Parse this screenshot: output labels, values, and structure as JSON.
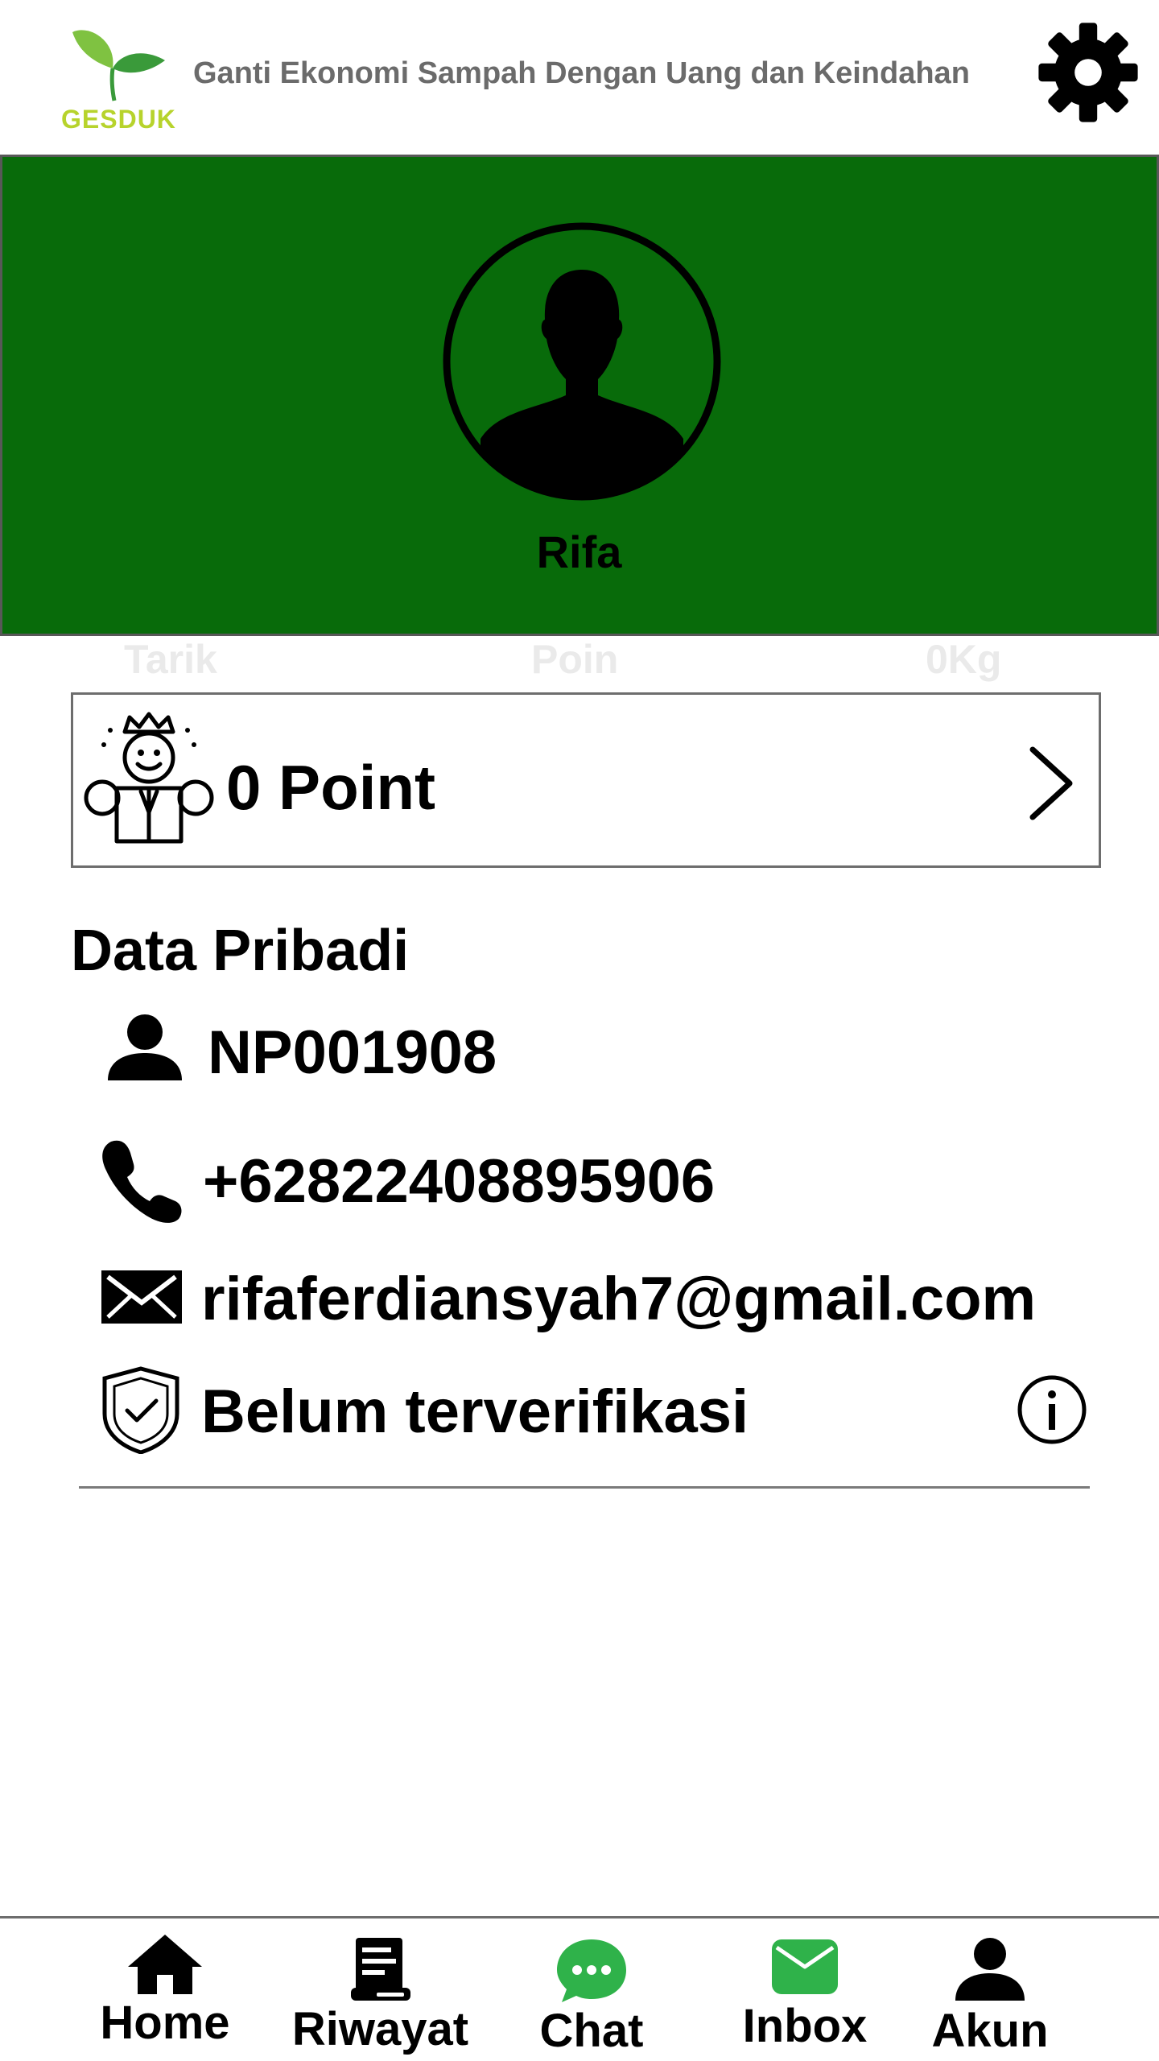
{
  "header": {
    "logo_text": "GESDUK",
    "tagline": "Ganti Ekonomi Sampah Dengan Uang dan Keindahan"
  },
  "profile": {
    "name": "Rifa"
  },
  "tabs": [
    "Tarik",
    "Poin",
    "0Kg"
  ],
  "points": {
    "label": "0 Point"
  },
  "personal": {
    "title": "Data Pribadi",
    "id": "NP001908",
    "phone": "+62822408895906",
    "email": "rifaferdiansyah7@gmail.com",
    "verification": "Belum terverifikasi"
  },
  "nav": {
    "home": "Home",
    "history": "Riwayat",
    "chat": "Chat",
    "inbox": "Inbox",
    "account": "Akun"
  },
  "colors": {
    "banner": "#086b0a",
    "logo_text": "#b7d32c",
    "chat_icon": "#2fb24a",
    "inbox_icon": "#2fb24a"
  },
  "icons": [
    "logo-leaf-icon",
    "gear-icon",
    "user-avatar-icon",
    "king-icon",
    "chevron-right-icon",
    "user-icon",
    "phone-icon",
    "mail-icon",
    "shield-check-icon",
    "info-icon",
    "home-icon",
    "history-icon",
    "chat-icon",
    "inbox-icon",
    "account-icon"
  ]
}
